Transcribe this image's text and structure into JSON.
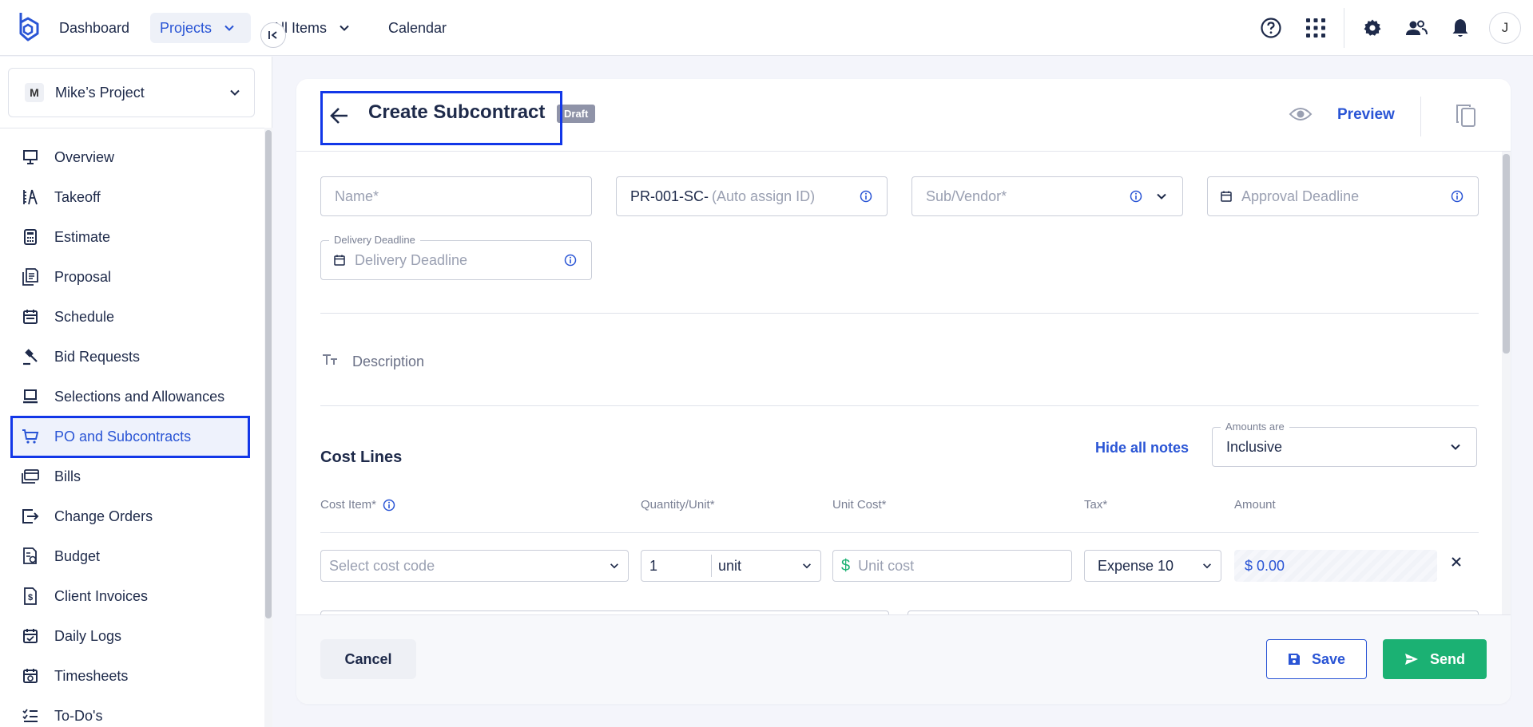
{
  "topnav": {
    "items": [
      {
        "label": "Dashboard"
      },
      {
        "label": "Projects"
      },
      {
        "label": "All Items"
      },
      {
        "label": "Calendar"
      }
    ],
    "icons": [
      "help-icon",
      "apps-grid-icon",
      "settings-icon",
      "users-icon",
      "bell-icon"
    ],
    "avatar_initial": "J"
  },
  "project": {
    "badge": "M",
    "name": "Mike’s Project"
  },
  "sidebar": {
    "items": [
      {
        "label": "Overview",
        "icon": "presentation-icon"
      },
      {
        "label": "Takeoff",
        "icon": "takeoff-icon"
      },
      {
        "label": "Estimate",
        "icon": "calculator-icon"
      },
      {
        "label": "Proposal",
        "icon": "document-icon"
      },
      {
        "label": "Schedule",
        "icon": "calendar-icon"
      },
      {
        "label": "Bid Requests",
        "icon": "gavel-icon"
      },
      {
        "label": "Selections and Allowances",
        "icon": "laptop-icon"
      },
      {
        "label": "PO and Subcontracts",
        "icon": "cart-icon"
      },
      {
        "label": "Bills",
        "icon": "bills-icon"
      },
      {
        "label": "Change Orders",
        "icon": "change-order-icon"
      },
      {
        "label": "Budget",
        "icon": "budget-icon"
      },
      {
        "label": "Client Invoices",
        "icon": "invoice-icon"
      },
      {
        "label": "Daily Logs",
        "icon": "daily-log-icon"
      },
      {
        "label": "Timesheets",
        "icon": "timesheet-icon"
      },
      {
        "label": "To-Do's",
        "icon": "todo-icon"
      }
    ],
    "active_index": 7
  },
  "header": {
    "title": "Create Subcontract",
    "status_badge": "Draft",
    "preview_label": "Preview"
  },
  "form": {
    "name_placeholder": "Name*",
    "id_prefix": "PR-001-SC-",
    "id_placeholder": "(Auto assign ID)",
    "vendor_placeholder": "Sub/Vendor*",
    "approval_placeholder": "Approval Deadline",
    "delivery_label": "Delivery Deadline",
    "delivery_placeholder": "Delivery Deadline",
    "description_label": "Description"
  },
  "cost_lines": {
    "title": "Cost Lines",
    "hide_notes": "Hide all notes",
    "amounts_label": "Amounts are",
    "amounts_value": "Inclusive",
    "columns": [
      "Cost Item*",
      "Quantity/Unit*",
      "Unit Cost*",
      "Tax*",
      "Amount"
    ],
    "row": {
      "cost_code_placeholder": "Select cost code",
      "quantity": "1",
      "unit": "unit",
      "currency_symbol": "$",
      "unit_cost_placeholder": "Unit cost",
      "tax": "Expense 10",
      "amount": "$ 0.00"
    }
  },
  "footer": {
    "cancel": "Cancel",
    "save": "Save",
    "send": "Send"
  },
  "colors": {
    "accent": "#2a55d5",
    "success": "#1bb173",
    "highlight": "#1237e8"
  }
}
